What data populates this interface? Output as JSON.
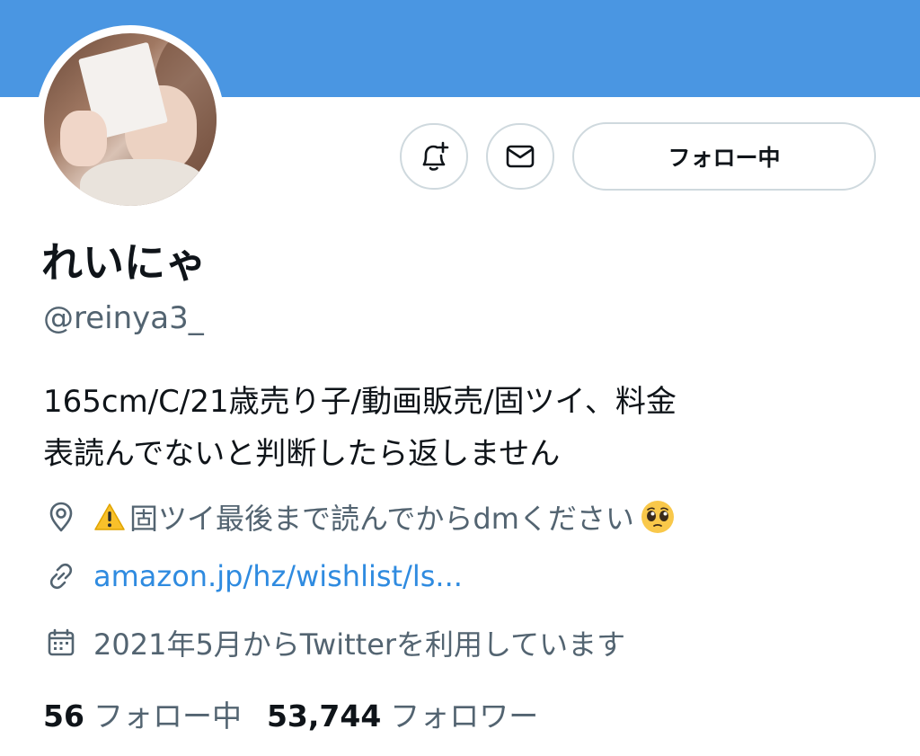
{
  "profile": {
    "display_name": "れいにゃ",
    "handle": "@reinya3_",
    "bio_line1": "165cm/C/21歳売り子/動画販売/固ツイ、料金",
    "bio_line2": "表読んでないと判断したら返しません",
    "location": "固ツイ最後まで読んでからdmください",
    "url": "amazon.jp/hz/wishlist/ls...",
    "joined": "2021年5月からTwitterを利用しています"
  },
  "actions": {
    "follow_label": "フォロー中"
  },
  "stats": {
    "following_count": "56",
    "following_label": "フォロー中",
    "followers_count": "53,744",
    "followers_label": "フォロワー"
  },
  "icons": {
    "bell": "bell-plus-icon",
    "mail": "envelope-icon",
    "location": "location-pin-icon",
    "link": "link-icon",
    "calendar": "calendar-icon",
    "warning": "warning-emoji",
    "pleading": "pleading-face-emoji"
  },
  "colors": {
    "banner": "#4a96e2",
    "link": "#2f8be0",
    "secondary_text": "#536471",
    "border": "#cfd9de"
  }
}
